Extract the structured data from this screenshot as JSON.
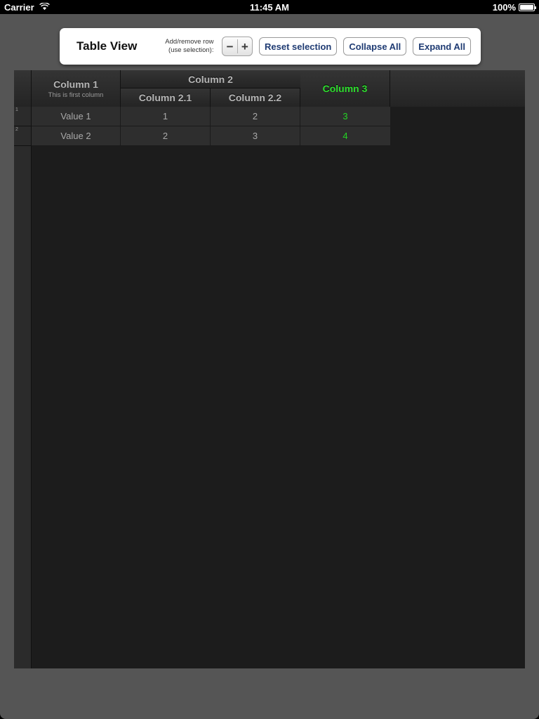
{
  "status_bar": {
    "carrier": "Carrier",
    "wifi_icon": "wifi-icon",
    "time": "11:45 AM",
    "battery_percent": "100%",
    "battery_icon": "battery-full-icon"
  },
  "toolbar": {
    "title": "Table View",
    "stepper_label_line1": "Add/remove row",
    "stepper_label_line2": "(use selection):",
    "minus_label": "−",
    "plus_label": "+",
    "buttons": [
      {
        "label": "Reset selection",
        "name": "reset-selection-button"
      },
      {
        "label": "Collapse All",
        "name": "collapse-all-button"
      },
      {
        "label": "Expand All",
        "name": "expand-all-button"
      }
    ]
  },
  "table": {
    "columns": {
      "col1_title": "Column 1",
      "col1_subtitle": "This is first column",
      "col2_title": "Column 2",
      "col2_1_title": "Column 2.1",
      "col2_2_title": "Column 2.2",
      "col3_title": "Column 3"
    },
    "accent_green": "#2fdd2f",
    "rows": [
      {
        "number": "1",
        "col1": "Value 1",
        "col2_1": "1",
        "col2_2": "2",
        "col3": "3"
      },
      {
        "number": "2",
        "col1": "Value 2",
        "col2_1": "2",
        "col2_2": "3",
        "col3": "4"
      }
    ]
  }
}
